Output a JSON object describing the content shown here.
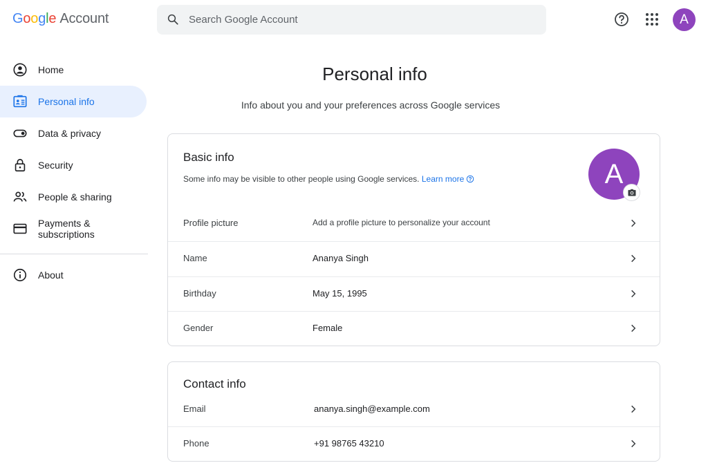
{
  "header": {
    "logo_google": "Google",
    "logo_account": "Account",
    "search_placeholder": "Search Google Account",
    "avatar_letter": "A",
    "accent": "#8e44bd"
  },
  "sidebar": {
    "items": [
      {
        "label": "Home",
        "icon": "home-icon"
      },
      {
        "label": "Personal info",
        "icon": "id-card-icon",
        "active": true
      },
      {
        "label": "Data & privacy",
        "icon": "toggle-icon"
      },
      {
        "label": "Security",
        "icon": "lock-icon"
      },
      {
        "label": "People & sharing",
        "icon": "people-icon"
      },
      {
        "label": "Payments & subscriptions",
        "icon": "credit-card-icon"
      }
    ],
    "about": {
      "label": "About",
      "icon": "info-icon"
    }
  },
  "main": {
    "title": "Personal info",
    "subtitle": "Info about you and your preferences across Google services"
  },
  "basic_info": {
    "title": "Basic info",
    "desc": "Some info may be visible to other people using Google services.",
    "learn_more": "Learn more",
    "avatar_letter": "A",
    "rows": [
      {
        "label": "Profile picture",
        "value": "Add a profile picture to personalize your account"
      },
      {
        "label": "Name",
        "value": "Ananya Singh"
      },
      {
        "label": "Birthday",
        "value": "May 15, 1995"
      },
      {
        "label": "Gender",
        "value": "Female"
      }
    ]
  },
  "contact_info": {
    "title": "Contact info",
    "rows": [
      {
        "label": "Email",
        "value": "ananya.singh@example.com"
      },
      {
        "label": "Phone",
        "value": "+91 98765 43210"
      }
    ]
  },
  "colors": {
    "blue": "#1a73e8",
    "active_bg": "#e8f0fe",
    "border": "#dadce0"
  }
}
